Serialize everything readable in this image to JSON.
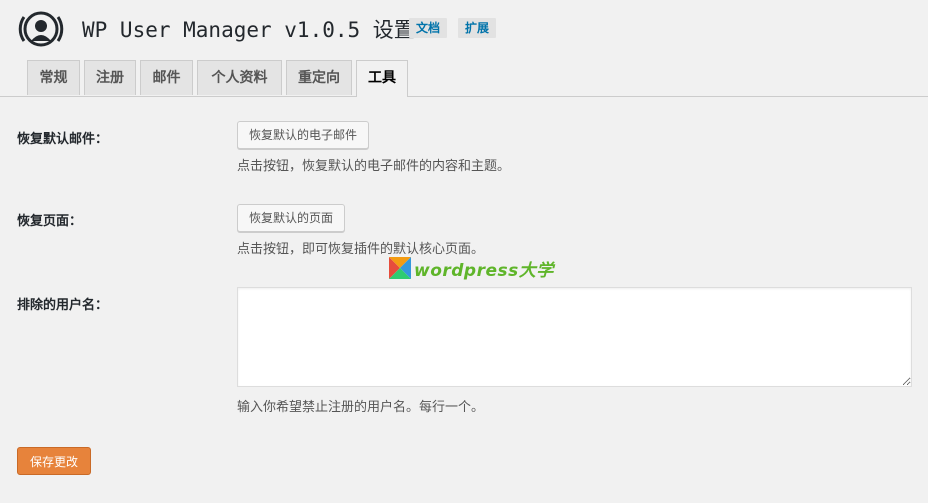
{
  "header": {
    "title": "WP User Manager v1.0.5 设置",
    "docs_badge": "文档",
    "extensions_badge": "扩展"
  },
  "tabs": [
    {
      "label": "常规"
    },
    {
      "label": "注册"
    },
    {
      "label": "邮件"
    },
    {
      "label": "个人资料"
    },
    {
      "label": "重定向"
    },
    {
      "label": "工具"
    }
  ],
  "tools": {
    "restore_emails": {
      "label": "恢复默认邮件：",
      "button": "恢复默认的电子邮件",
      "description": "点击按钮，恢复默认的电子邮件的内容和主题。"
    },
    "restore_pages": {
      "label": "恢复页面：",
      "button": "恢复默认的页面",
      "description": "点击按钮，即可恢复插件的默认核心页面。"
    },
    "excluded_usernames": {
      "label": "排除的用户名：",
      "value": "",
      "description": "输入你希望禁止注册的用户名。每行一个。"
    }
  },
  "save_button": "保存更改",
  "watermark": {
    "text": "wordpress大学",
    "colors": [
      "#e74c3c",
      "#f39c12",
      "#3498db",
      "#2ecc71"
    ]
  },
  "colors": {
    "accent_button": "#e7833b",
    "link": "#0073aa"
  }
}
